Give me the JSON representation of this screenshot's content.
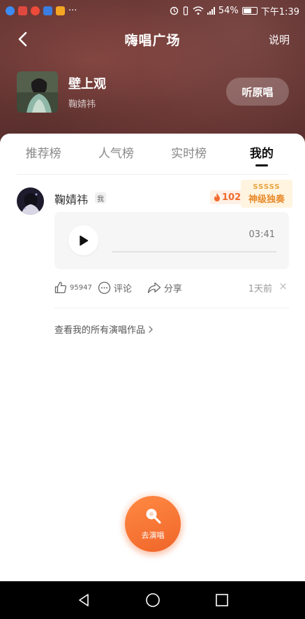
{
  "status_bar": {
    "battery": "54%",
    "time": "下午1:39",
    "overflow": "···"
  },
  "nav": {
    "title": "嗨唱广场",
    "help": "说明"
  },
  "song": {
    "title": "壁上观",
    "artist": "鞠婧祎",
    "listen_button": "听原唱"
  },
  "tabs": [
    {
      "label": "推荐榜",
      "active": false
    },
    {
      "label": "人气榜",
      "active": false
    },
    {
      "label": "实时榜",
      "active": false
    },
    {
      "label": "我的",
      "active": true
    }
  ],
  "performance": {
    "user_name": "鞠婧祎",
    "me_badge": "我",
    "heat": "102",
    "grade_letters": "SSSSS",
    "grade_label": "神级独奏",
    "duration": "03:41",
    "progress": 0,
    "likes": "95947",
    "comment_label": "评论",
    "share_label": "分享",
    "time_ago": "1天前",
    "close": "×"
  },
  "all_works_link": "查看我的所有演唱作品",
  "sing_button": "去演唱",
  "colors": {
    "header_bg": "#6e3a37",
    "accent_orange": "#f0652a",
    "grade_gold": "#e88a2a"
  },
  "icons": {
    "back": "chevron-left-icon",
    "play": "play-icon",
    "like": "thumb-up-icon",
    "comment": "comment-bubble-icon",
    "share": "share-arrow-icon",
    "sing": "microphone-icon",
    "heat": "flame-icon"
  }
}
